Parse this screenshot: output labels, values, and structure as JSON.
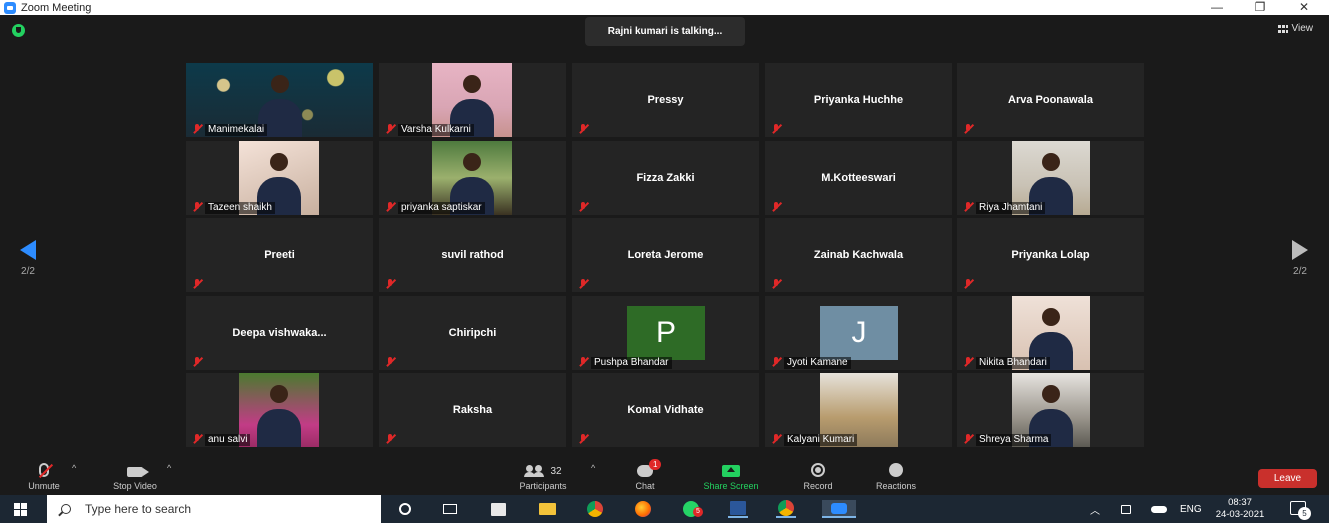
{
  "window": {
    "title": "Zoom Meeting",
    "controls": [
      "—",
      "❐",
      "✕"
    ]
  },
  "talking_indicator": "Rajni kumari is talking...",
  "view_button": "View",
  "page_left": "2/2",
  "page_right": "2/2",
  "tiles": [
    {
      "name": "Manimekalai",
      "kind": "video",
      "style": "v-bokeh",
      "person": true,
      "vx": 0,
      "vw": 187
    },
    {
      "name": "Varsha Kulkarni",
      "kind": "video",
      "style": "v-room1",
      "person": true,
      "vx": 53,
      "vw": 80
    },
    {
      "name": "Pressy",
      "kind": "name"
    },
    {
      "name": "Priyanka Huchhe",
      "kind": "name"
    },
    {
      "name": "Arva Poonawala",
      "kind": "name"
    },
    {
      "name": "Tazeen shaikh",
      "kind": "video",
      "style": "v-room2",
      "person": true,
      "vx": 53,
      "vw": 80
    },
    {
      "name": "priyanka saptiskar",
      "kind": "video",
      "style": "v-room3",
      "person": true,
      "vx": 53,
      "vw": 80
    },
    {
      "name": "Fizza Zakki",
      "kind": "name"
    },
    {
      "name": "M.Kotteeswari",
      "kind": "name"
    },
    {
      "name": "Riya Jhamtani",
      "kind": "video",
      "style": "v-beach",
      "person": true,
      "vx": 55,
      "vw": 78
    },
    {
      "name": "Preeti",
      "kind": "name"
    },
    {
      "name": "suvil rathod",
      "kind": "name"
    },
    {
      "name": "Loreta Jerome",
      "kind": "name"
    },
    {
      "name": "Zainab Kachwala",
      "kind": "name"
    },
    {
      "name": "Priyanka Lolap",
      "kind": "name"
    },
    {
      "name": "Deepa  vishwaka...",
      "kind": "name"
    },
    {
      "name": "Chiripchi",
      "kind": "name"
    },
    {
      "name": "Pushpa Bhandar",
      "kind": "avatar",
      "letter": "P",
      "color": "#2e6b26"
    },
    {
      "name": "Jyoti Kamane",
      "kind": "avatar",
      "letter": "J",
      "color": "#6f8ea3"
    },
    {
      "name": "Nikita Bhandari",
      "kind": "video",
      "style": "v-wall",
      "person": true,
      "vx": 55,
      "vw": 78
    },
    {
      "name": "anu salvi",
      "kind": "video",
      "style": "v-pink",
      "person": true,
      "vx": 53,
      "vw": 80
    },
    {
      "name": "Raksha",
      "kind": "name"
    },
    {
      "name": "Komal Vidhate",
      "kind": "name"
    },
    {
      "name": "Kalyani Kumari",
      "kind": "video",
      "style": "v-statue",
      "person": false,
      "vx": 55,
      "vw": 78
    },
    {
      "name": "Shreya Sharma",
      "kind": "video",
      "style": "v-outdoor",
      "person": true,
      "vx": 55,
      "vw": 78
    }
  ],
  "toolbar": {
    "unmute": "Unmute",
    "stop_video": "Stop Video",
    "participants": "Participants",
    "participants_count": "32",
    "chat": "Chat",
    "chat_badge": "1",
    "share_screen": "Share Screen",
    "record": "Record",
    "reactions": "Reactions",
    "leave": "Leave",
    "caret": "^"
  },
  "taskbar": {
    "search_placeholder": "Type here to search",
    "language": "ENG",
    "time": "08:37",
    "date": "24-03-2021",
    "whatsapp_badge": "5",
    "notification_count": "5"
  },
  "colors": {
    "accent_blue": "#2d8cff",
    "share_green": "#23d160",
    "mute_red": "#e02828",
    "leave_red": "#c9302c"
  }
}
